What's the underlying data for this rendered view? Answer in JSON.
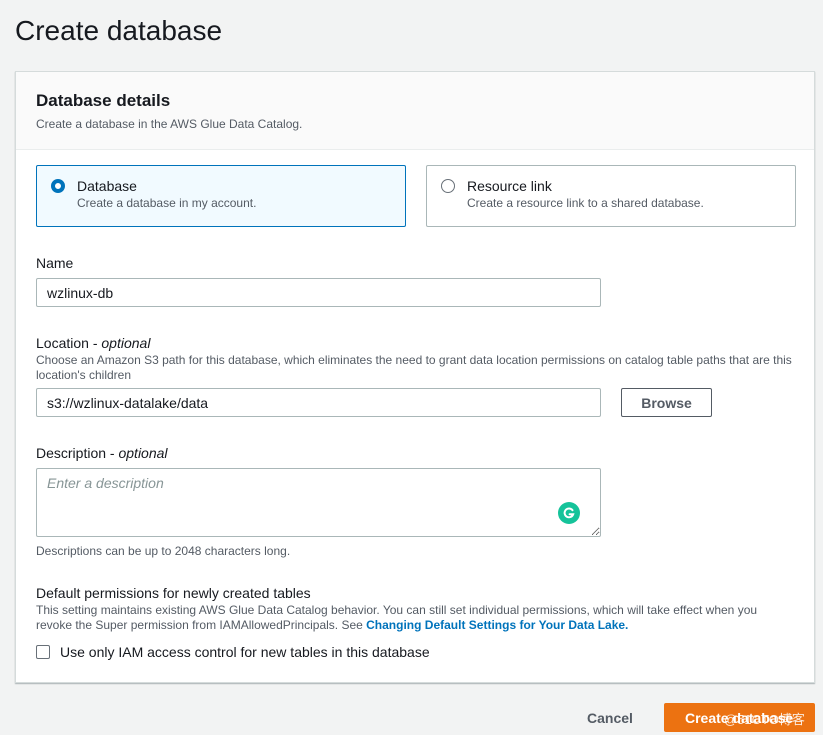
{
  "page": {
    "title": "Create database"
  },
  "details": {
    "title": "Database details",
    "description": "Create a database in the AWS Glue Data Catalog."
  },
  "options": [
    {
      "title": "Database",
      "subtitle": "Create a database in my account.",
      "selected": true
    },
    {
      "title": "Resource link",
      "subtitle": "Create a resource link to a shared database.",
      "selected": false
    }
  ],
  "name": {
    "label": "Name",
    "value": "wzlinux-db"
  },
  "location": {
    "label": "Location",
    "optional": "optional",
    "hint": "Choose an Amazon S3 path for this database, which eliminates the need to grant data location permissions on catalog table paths that are this location's children",
    "value": "s3://wzlinux-datalake/data",
    "browse_label": "Browse"
  },
  "description": {
    "label": "Description",
    "optional": "optional",
    "placeholder": "Enter a description",
    "hint": "Descriptions can be up to 2048 characters long."
  },
  "permissions": {
    "title": "Default permissions for newly created tables",
    "text": "This setting maintains existing AWS Glue Data Catalog behavior. You can still set individual permissions, which will take effect when you revoke the Super permission from IAMAllowedPrincipals. See ",
    "link": "Changing Default Settings for Your Data Lake.",
    "checkbox_label": "Use only IAM access control for new tables in this database",
    "checked": false
  },
  "footer": {
    "cancel_label": "Cancel",
    "create_label": "Create database",
    "watermark": "@51CTO博客"
  },
  "colors": {
    "primary": "#ec7211",
    "selected_border": "#0073bb",
    "link": "#0073bb"
  },
  "icons": {
    "grammarly": "grammarly-icon"
  }
}
